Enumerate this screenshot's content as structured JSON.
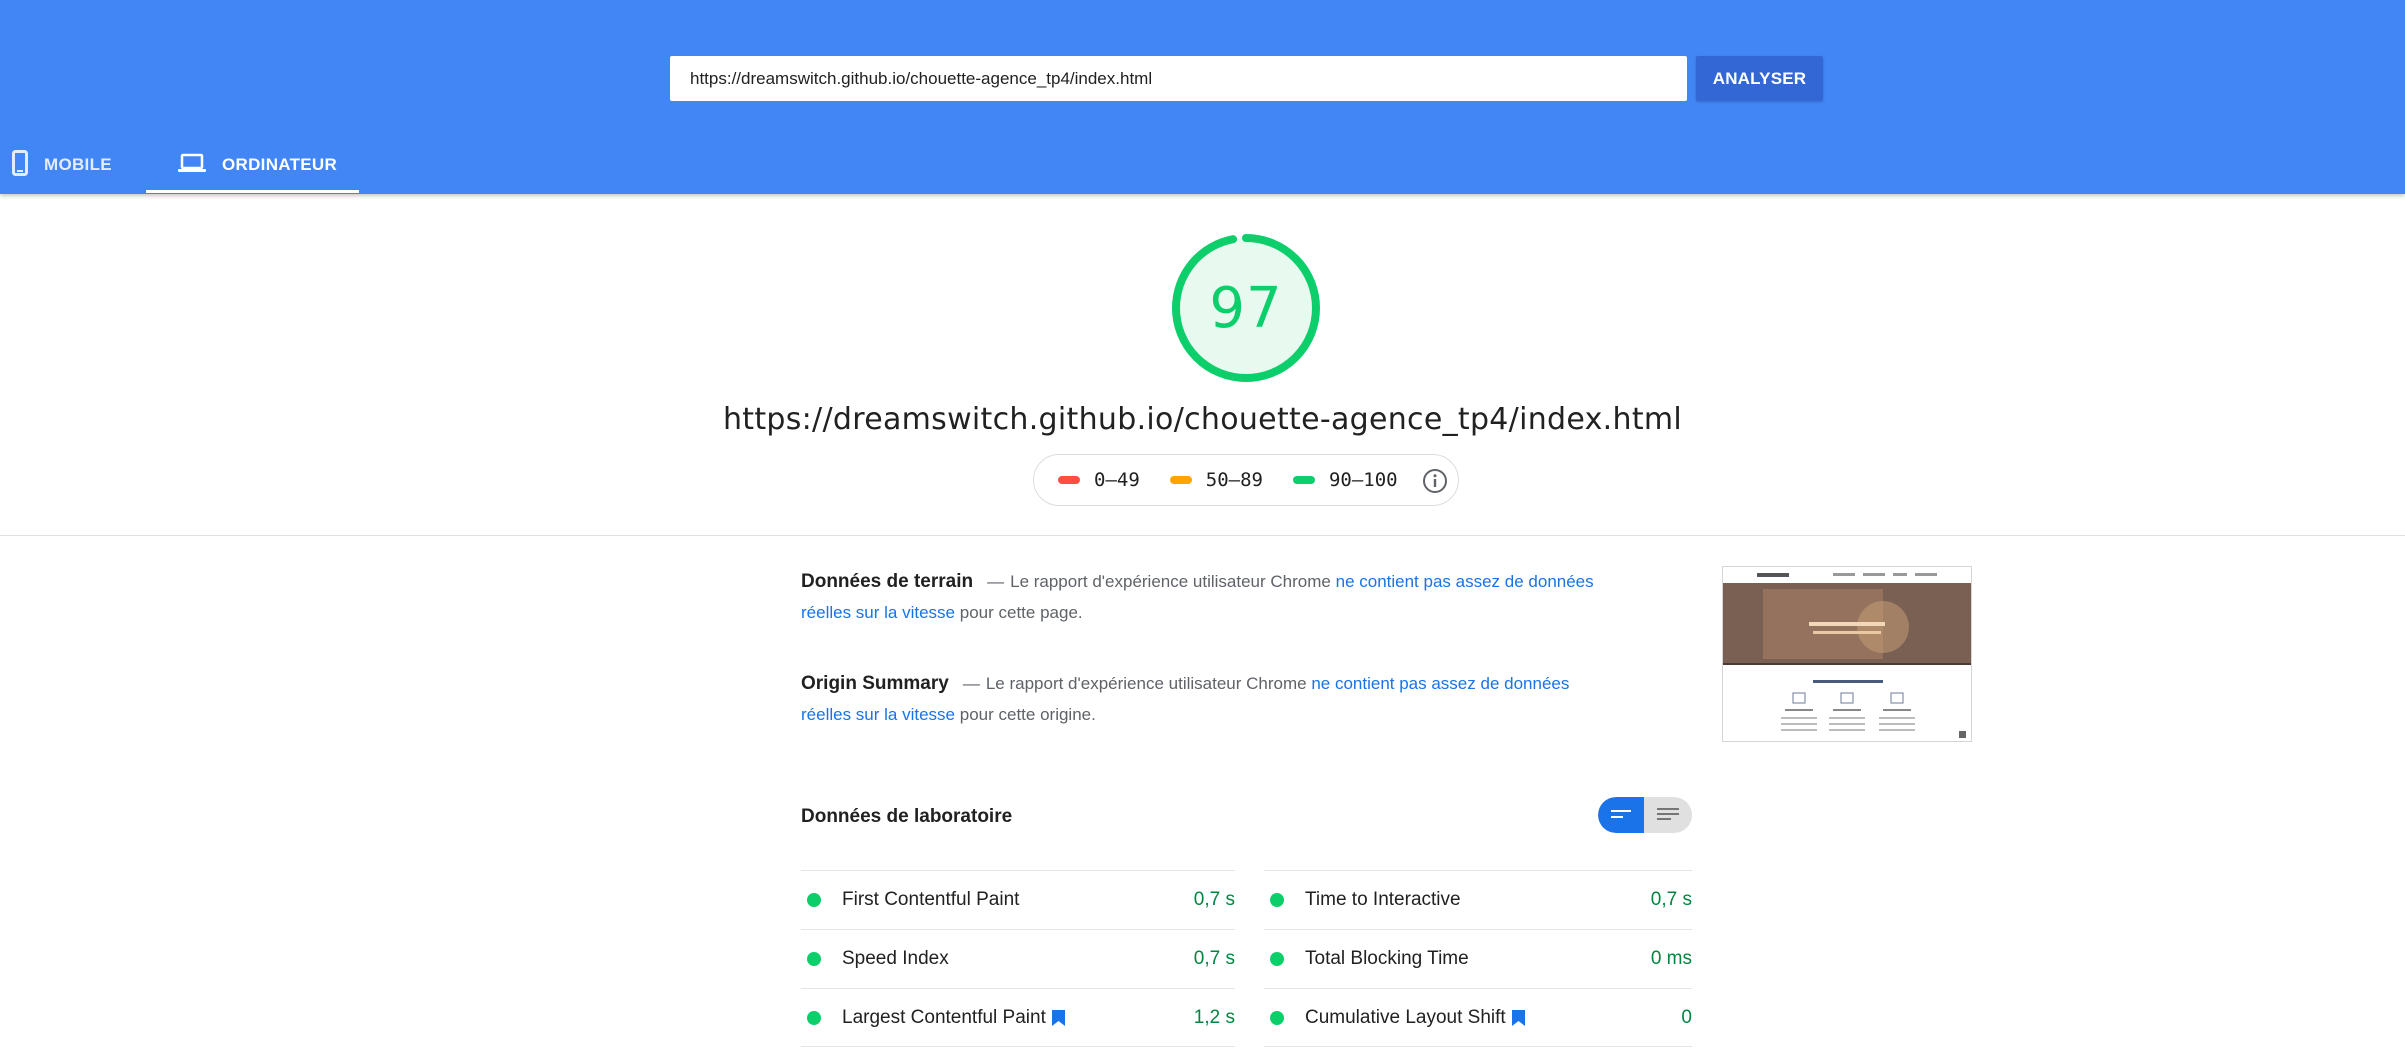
{
  "header": {
    "url_value": "https://dreamswitch.github.io/chouette-agence_tp4/index.html",
    "analyse_label": "ANALYSER",
    "tabs": [
      {
        "label": "MOBILE",
        "icon": "smartphone-icon",
        "active": false
      },
      {
        "label": "ORDINATEUR",
        "icon": "laptop-icon",
        "active": true
      }
    ]
  },
  "score": {
    "value": "97",
    "progress": 0.97,
    "color": "#0cce6b",
    "url": "https://dreamswitch.github.io/chouette-agence_tp4/index.html"
  },
  "legend": [
    {
      "label": "0–49",
      "color": "#ff4e42"
    },
    {
      "label": "50–89",
      "color": "#ffa400"
    },
    {
      "label": "90–100",
      "color": "#0cce6b"
    }
  ],
  "field_data": {
    "title": "Données de terrain",
    "dash": "—",
    "text_before": "Le rapport d'expérience utilisateur Chrome",
    "link": "ne contient pas assez de données réelles sur la vitesse",
    "text_after": "pour cette page."
  },
  "origin_summary": {
    "title": "Origin Summary",
    "dash": "—",
    "text_before": "Le rapport d'expérience utilisateur Chrome",
    "link": "ne contient pas assez de données réelles sur la vitesse",
    "text_after": "pour cette origine."
  },
  "lab_data": {
    "title": "Données de laboratoire",
    "metrics_left": [
      {
        "label": "First Contentful Paint",
        "value": "0,7 s",
        "bookmark": false
      },
      {
        "label": "Speed Index",
        "value": "0,7 s",
        "bookmark": false
      },
      {
        "label": "Largest Contentful Paint",
        "value": "1,2 s",
        "bookmark": true
      }
    ],
    "metrics_right": [
      {
        "label": "Time to Interactive",
        "value": "0,7 s",
        "bookmark": false
      },
      {
        "label": "Total Blocking Time",
        "value": "0 ms",
        "bookmark": false
      },
      {
        "label": "Cumulative Layout Shift",
        "value": "0",
        "bookmark": true
      }
    ]
  },
  "colors": {
    "header": "#4285f4",
    "button": "#3367d6",
    "link": "#1a73e8",
    "pass": "#0cce6b",
    "pass_text": "#018642"
  }
}
